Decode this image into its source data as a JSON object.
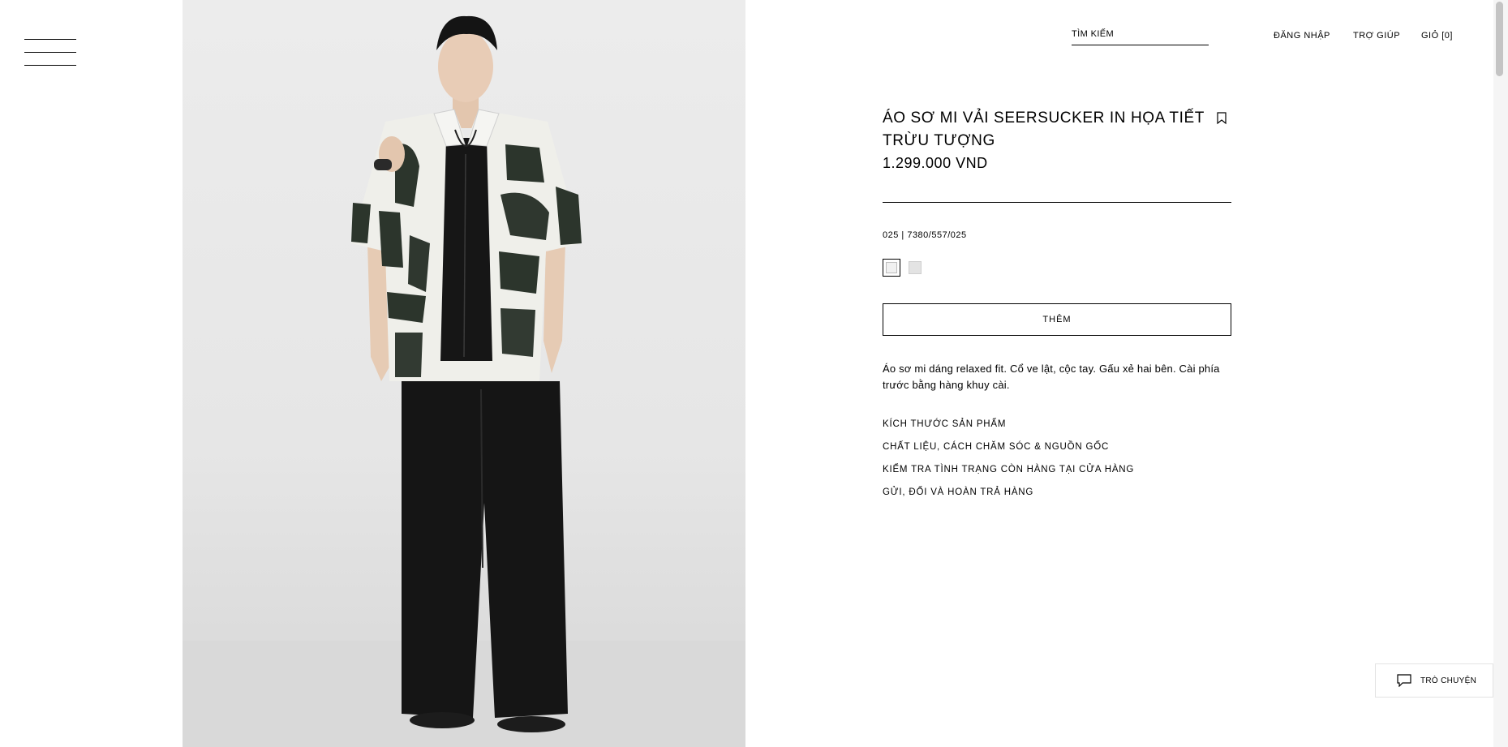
{
  "header": {
    "search_label": "TÌM KIẾM",
    "nav": {
      "login": "ĐĂNG NHẬP",
      "help": "TRỢ GIÚP",
      "cart": "GIỎ [0]"
    }
  },
  "product": {
    "title": "ÁO SƠ MI VẢI SEERSUCKER IN HỌA TIẾT TRỪU TƯỢNG",
    "price": "1.299.000 VND",
    "reference": "025 | 7380/557/025",
    "add_label": "THÊM",
    "description": "Áo sơ mi dáng relaxed fit. Cổ ve lật, cộc tay. Gấu xẻ hai bên. Cài phía trước bằng hàng khuy cài.",
    "info_links": [
      "KÍCH THƯỚC SẢN PHẨM",
      "CHẤT LIỆU, CÁCH CHĂM SÓC & NGUỒN GỐC",
      "KIỂM TRA TÌNH TRẠNG CÒN HÀNG TẠI CỬA HÀNG",
      "GỬI, ĐỔI VÀ HOÀN TRẢ HÀNG"
    ],
    "colors": [
      {
        "hex": "#f1f1f1",
        "selected": true
      },
      {
        "hex": "#e3e3e3",
        "selected": false
      }
    ]
  },
  "chat": {
    "label": "TRÒ CHUYỆN"
  },
  "icons": {
    "menu": "hamburger-menu-icon",
    "bookmark": "bookmark-icon",
    "chat": "chat-bubble-icon"
  }
}
